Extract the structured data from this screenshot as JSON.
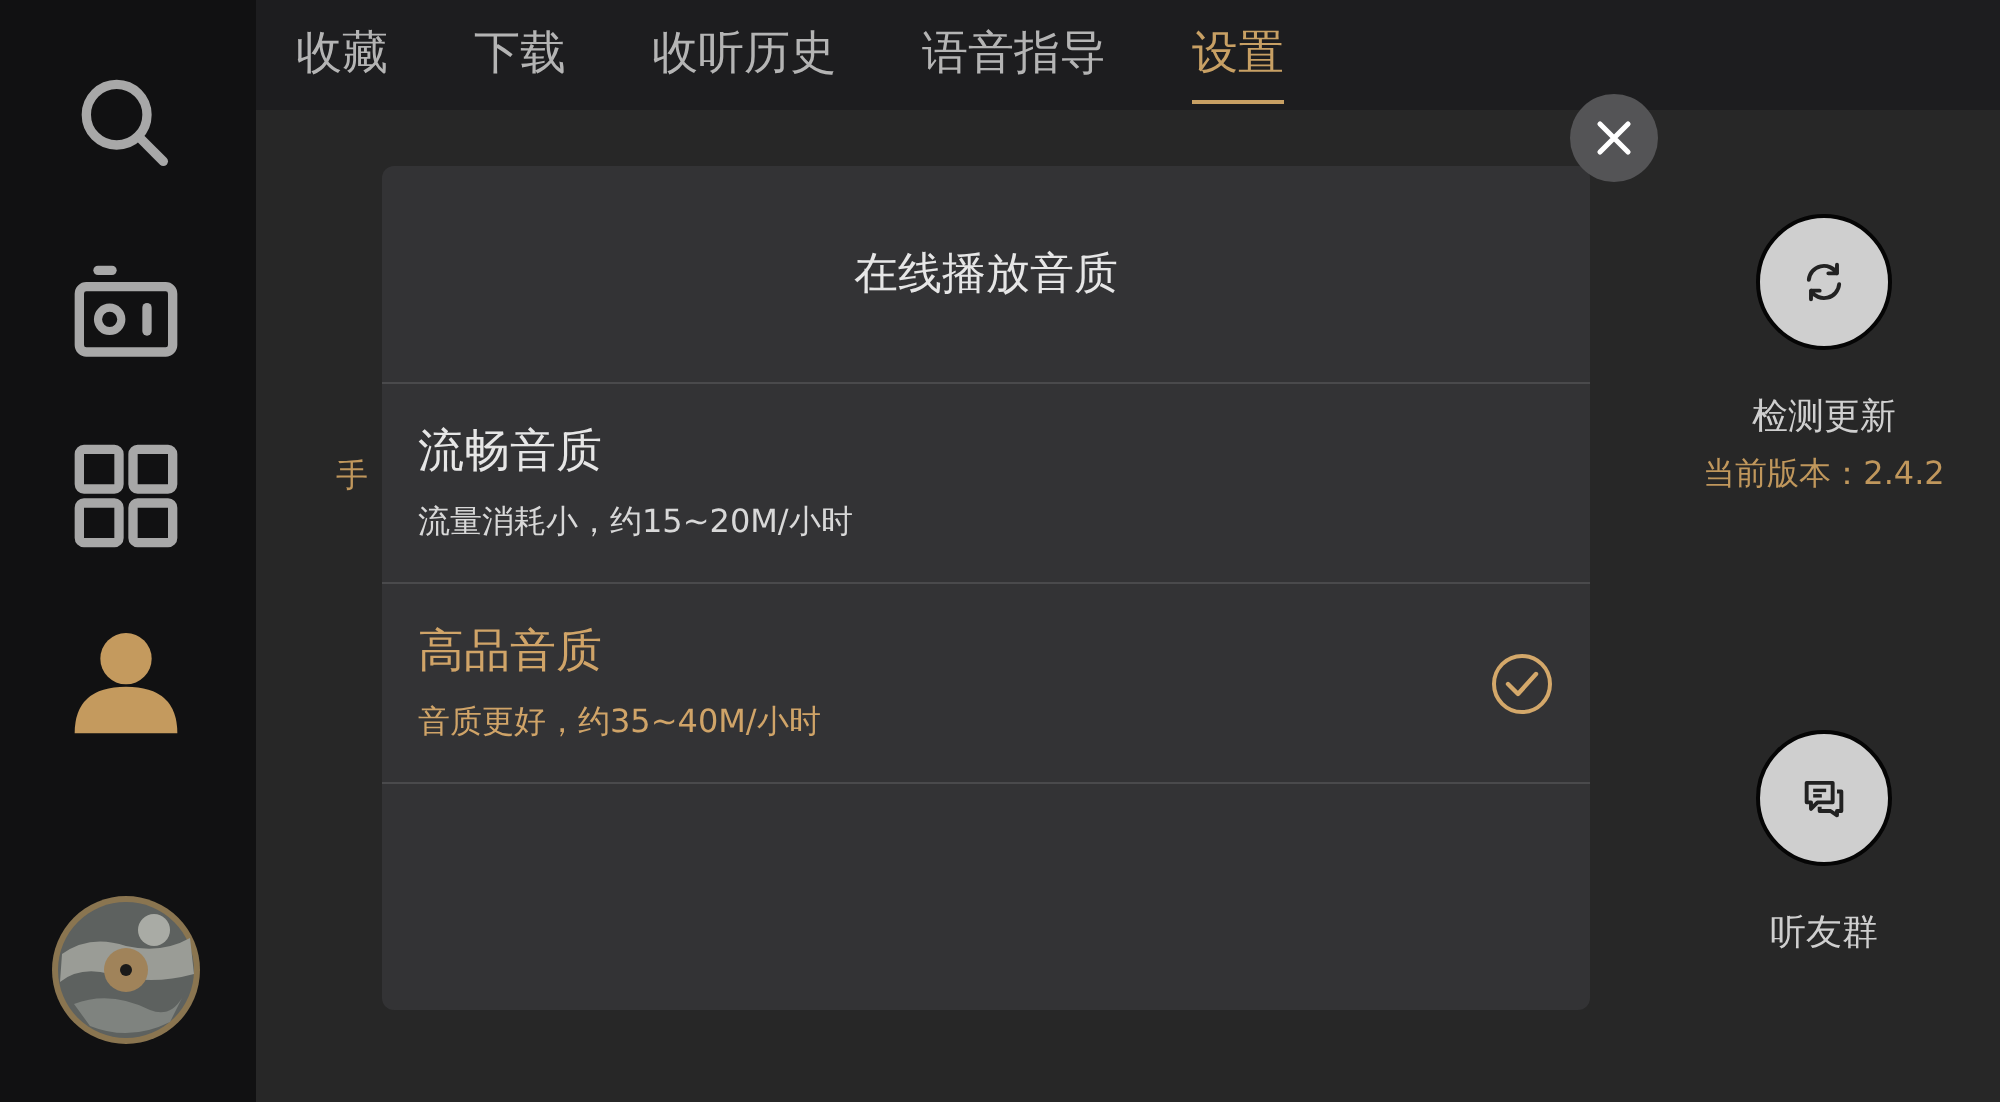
{
  "sidebar": {
    "items": [
      {
        "selected": false
      },
      {
        "selected": false
      },
      {
        "selected": false
      },
      {
        "selected": true
      }
    ]
  },
  "tabs": [
    {
      "label": "收藏",
      "selected": false
    },
    {
      "label": "下载",
      "selected": false
    },
    {
      "label": "收听历史",
      "selected": false
    },
    {
      "label": "语音指导",
      "selected": false
    },
    {
      "label": "设置",
      "selected": true
    }
  ],
  "content": {
    "hidden_label": "手",
    "update_button": {
      "label": "检测更新",
      "version": "当前版本：2.4.2"
    },
    "group_button": {
      "label": "听友群"
    }
  },
  "dialog": {
    "title": "在线播放音质",
    "options": [
      {
        "title": "流畅音质",
        "description": "流量消耗小，约15~20M/小时",
        "selected": false
      },
      {
        "title": "高品音质",
        "description": "音质更好，约35~40M/小时",
        "selected": true
      }
    ]
  }
}
